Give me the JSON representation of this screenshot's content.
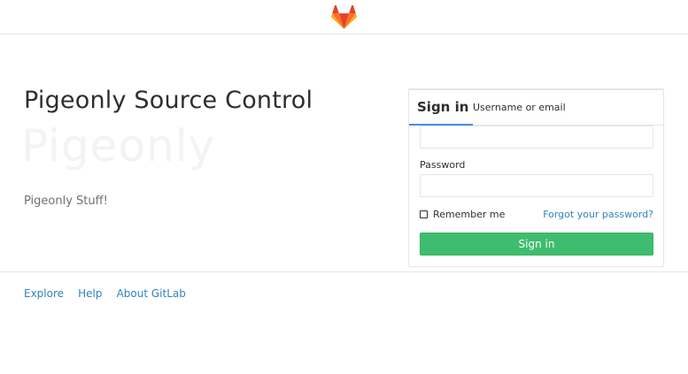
{
  "header": {
    "logo_icon": "gitlab-tanuki-icon",
    "logo_colors": [
      "#e24329",
      "#fc6d26",
      "#fca326"
    ]
  },
  "brand": {
    "title": "Pigeonly Source Control",
    "watermark": "Pigeonly",
    "description": "Pigeonly Stuff!"
  },
  "login": {
    "tabs": [
      {
        "label": "Sign in",
        "active": true
      },
      {
        "label": "Username or email",
        "active": false
      }
    ],
    "login_value": "",
    "password_label": "Password",
    "password_value": "",
    "remember_label": "Remember me",
    "remember_checked": false,
    "forgot_link": "Forgot your password?",
    "submit_label": "Sign in"
  },
  "footer": {
    "links": [
      "Explore",
      "Help",
      "About GitLab"
    ]
  },
  "colors": {
    "accent_tab": "#4a8bee",
    "button_green": "#3fbd6e",
    "link_blue": "#3084bb"
  }
}
